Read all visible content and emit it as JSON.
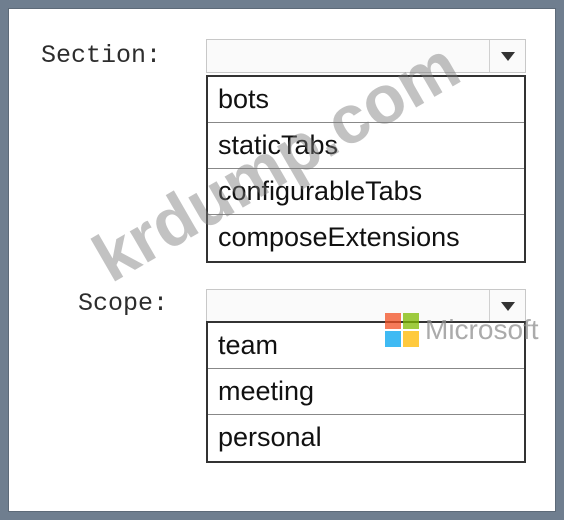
{
  "section": {
    "label": "Section:",
    "selected": "",
    "options": [
      "bots",
      "staticTabs",
      "configurableTabs",
      "composeExtensions"
    ]
  },
  "scope": {
    "label": "Scope:",
    "selected": "",
    "options": [
      "team",
      "meeting",
      "personal"
    ]
  },
  "watermark": {
    "text": "krdump.com"
  },
  "logo": {
    "text": "Microsoft",
    "colors": [
      "#f25022",
      "#7fba00",
      "#00a4ef",
      "#ffb900"
    ]
  },
  "colors": {
    "background": "#6f7e8f",
    "panel": "#ffffff",
    "list_border": "#333333"
  }
}
